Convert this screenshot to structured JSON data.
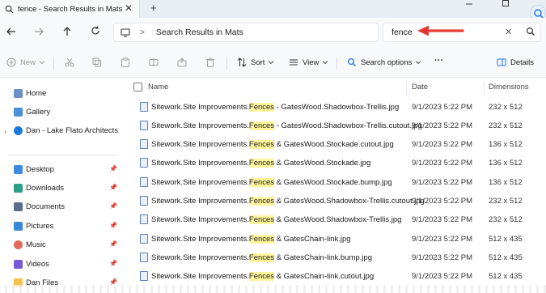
{
  "tab": {
    "title": "fence - Search Results in Mats",
    "close_icon": "close-icon",
    "new_tab_label": "+"
  },
  "address": {
    "location": "Search Results in Mats",
    "separator": ">"
  },
  "search": {
    "value": "fence",
    "clear_label": "✕"
  },
  "commands": {
    "new_label": "New",
    "sort_label": "Sort",
    "view_label": "View",
    "search_options_label": "Search options",
    "more_label": "···",
    "details_label": "Details"
  },
  "sidebar": {
    "top_items": [
      {
        "label": "Home",
        "icon": "home-icon"
      },
      {
        "label": "Gallery",
        "icon": "gallery-icon"
      },
      {
        "label": "Dan - Lake Flato Architects",
        "icon": "cloud-icon"
      }
    ],
    "quick_items": [
      {
        "label": "Desktop",
        "icon": "desktop-icon"
      },
      {
        "label": "Downloads",
        "icon": "download-icon"
      },
      {
        "label": "Documents",
        "icon": "documents-icon"
      },
      {
        "label": "Pictures",
        "icon": "pictures-icon"
      },
      {
        "label": "Music",
        "icon": "music-icon"
      },
      {
        "label": "Videos",
        "icon": "videos-icon"
      },
      {
        "label": "Dan Files",
        "icon": "folder-icon"
      }
    ]
  },
  "list": {
    "columns": {
      "name": "Name",
      "date": "Date",
      "dimensions": "Dimensions"
    },
    "rows": [
      {
        "pre": "Sitework.Site Improvements.",
        "match": "Fences",
        "post": " - GatesWood.Shadowbox-Trellis.jpg",
        "date": "9/1/2023 5:22 PM",
        "dim": "232 x 512"
      },
      {
        "pre": "Sitework.Site Improvements.",
        "match": "Fences",
        "post": " - GatesWood.Shadowbox-Trellis.cutout.jpg",
        "date": "9/1/2023 5:22 PM",
        "dim": "232 x 512"
      },
      {
        "pre": "Sitework.Site Improvements.",
        "match": "Fences",
        "post": " & GatesWood.Stockade.cutout.jpg",
        "date": "9/1/2023 5:22 PM",
        "dim": "136 x 512"
      },
      {
        "pre": "Sitework.Site Improvements.",
        "match": "Fences",
        "post": " & GatesWood.Stockade.jpg",
        "date": "9/1/2023 5:22 PM",
        "dim": "136 x 512"
      },
      {
        "pre": "Sitework.Site Improvements.",
        "match": "Fences",
        "post": " & GatesWood.Stockade.bump.jpg",
        "date": "9/1/2023 5:22 PM",
        "dim": "136 x 512"
      },
      {
        "pre": "Sitework.Site Improvements.",
        "match": "Fences",
        "post": " & GatesWood.Shadowbox-Trellis.cutout.jpg",
        "date": "9/1/2023 5:22 PM",
        "dim": "232 x 512"
      },
      {
        "pre": "Sitework.Site Improvements.",
        "match": "Fences",
        "post": " & GatesWood.Shadowbox-Trellis.jpg",
        "date": "9/1/2023 5:22 PM",
        "dim": "232 x 512"
      },
      {
        "pre": "Sitework.Site Improvements.",
        "match": "Fences",
        "post": " & GatesChain-link.jpg",
        "date": "9/1/2023 5:22 PM",
        "dim": "512 x 435"
      },
      {
        "pre": "Sitework.Site Improvements.",
        "match": "Fences",
        "post": " & GatesChain-link.bump.jpg",
        "date": "9/1/2023 5:22 PM",
        "dim": "512 x 435"
      },
      {
        "pre": "Sitework.Site Improvements.",
        "match": "Fences",
        "post": " & GatesChain-link.cutout.jpg",
        "date": "9/1/2023 5:22 PM",
        "dim": "512 x 435"
      }
    ]
  },
  "colors": {
    "highlight": "#fff59d",
    "arrow": "#e53935",
    "accent": "#1a73e8"
  }
}
